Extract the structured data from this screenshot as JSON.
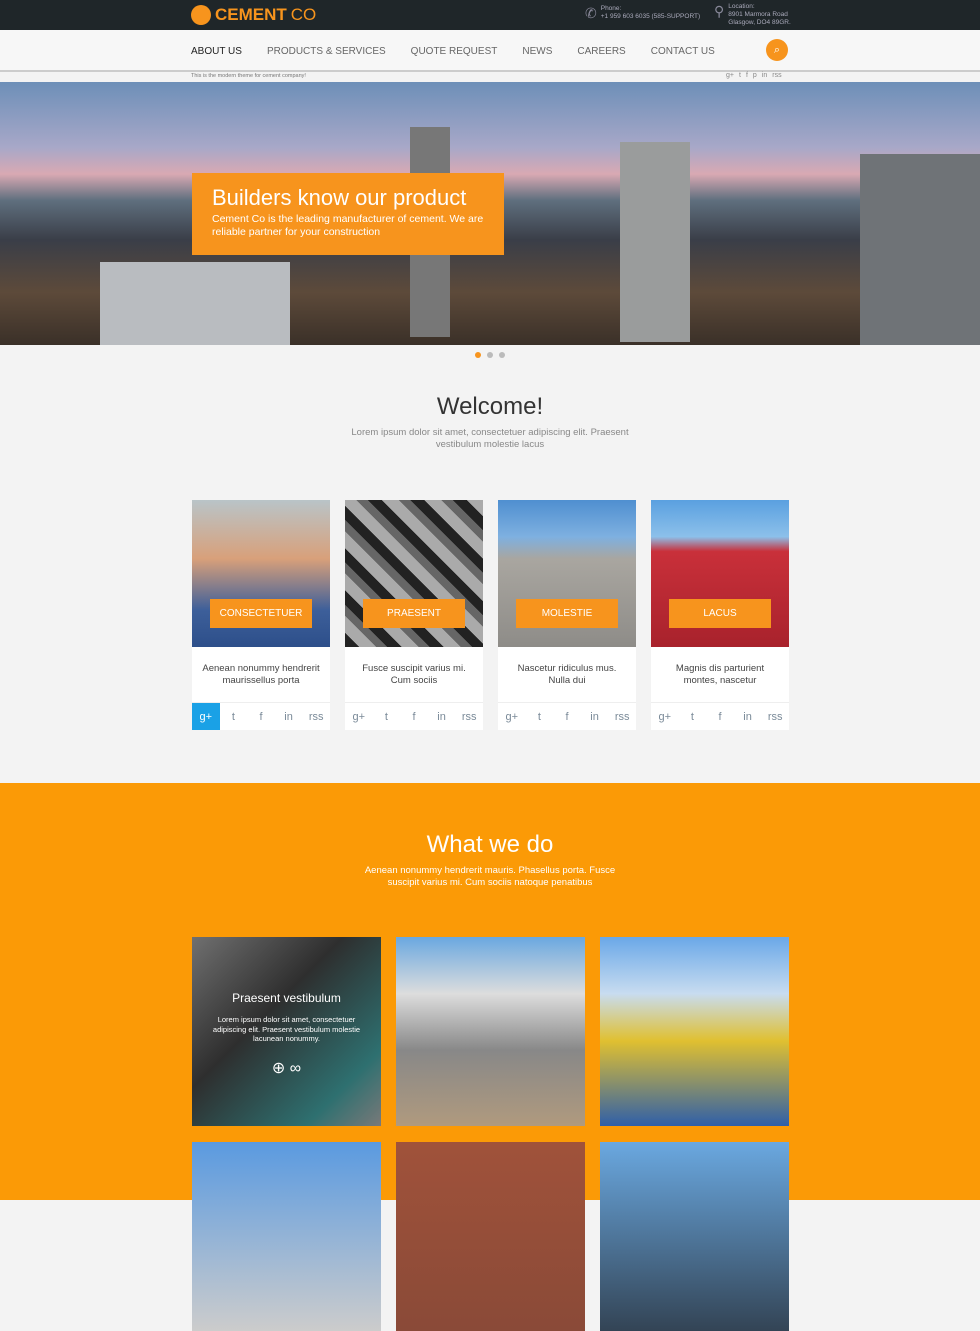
{
  "brand": {
    "name": "CEMENT",
    "suffix": "CO"
  },
  "contact": {
    "phone_label": "Phone:",
    "phone": "+1 959 603 6035 (585-SUPPORT)",
    "location_label": "Location:",
    "address1": "8901 Marmora Road",
    "address2": "Glasgow, DO4 89GR."
  },
  "nav": {
    "items": [
      "ABOUT US",
      "PRODUCTS & SERVICES",
      "QUOTE REQUEST",
      "NEWS",
      "CAREERS",
      "CONTACT US"
    ],
    "active": "ABOUT US",
    "search_icon": "search-icon"
  },
  "tagline": "This is the modern theme for cement company!",
  "top_social": [
    "g+",
    "t",
    "f",
    "p",
    "in",
    "rss"
  ],
  "hero": {
    "title": "Builders know our product",
    "text": "Cement Co is the leading manufacturer of cement. We are reliable partner for your construction",
    "slides": 3,
    "active_slide": 1
  },
  "welcome": {
    "title": "Welcome!",
    "text": "Lorem ipsum dolor sit amet, consectetuer adipiscing elit. Praesent vestibulum molestie lacus"
  },
  "cards": [
    {
      "button": "CONSECTETUER",
      "text": "Aenean nonummy hendrerit maurissellus porta"
    },
    {
      "button": "PRAESENT",
      "text": "Fusce suscipit varius mi. Cum sociis"
    },
    {
      "button": "MOLESTIE",
      "text": "Nascetur ridiculus mus. Nulla dui"
    },
    {
      "button": "LACUS",
      "text": "Magnis dis parturient montes, nascetur"
    }
  ],
  "card_social": [
    "g+",
    "t",
    "f",
    "in",
    "rss"
  ],
  "what": {
    "title": "What we do",
    "text": "Aenean nonummy hendrerit mauris. Phasellus porta. Fusce suscipit varius mi. Cum sociis natoque penatibus",
    "overlay_title": "Praesent vestibulum",
    "overlay_text": "Lorem ipsum dolor sit amet, consectetuer adipiscing elit. Praesent vestibulum molestie lacunean nonummy."
  },
  "colors": {
    "accent": "#f7941d",
    "orange_bg": "#fb9a06",
    "topbar": "#1f2629",
    "google_active": "#1aa1e6"
  }
}
